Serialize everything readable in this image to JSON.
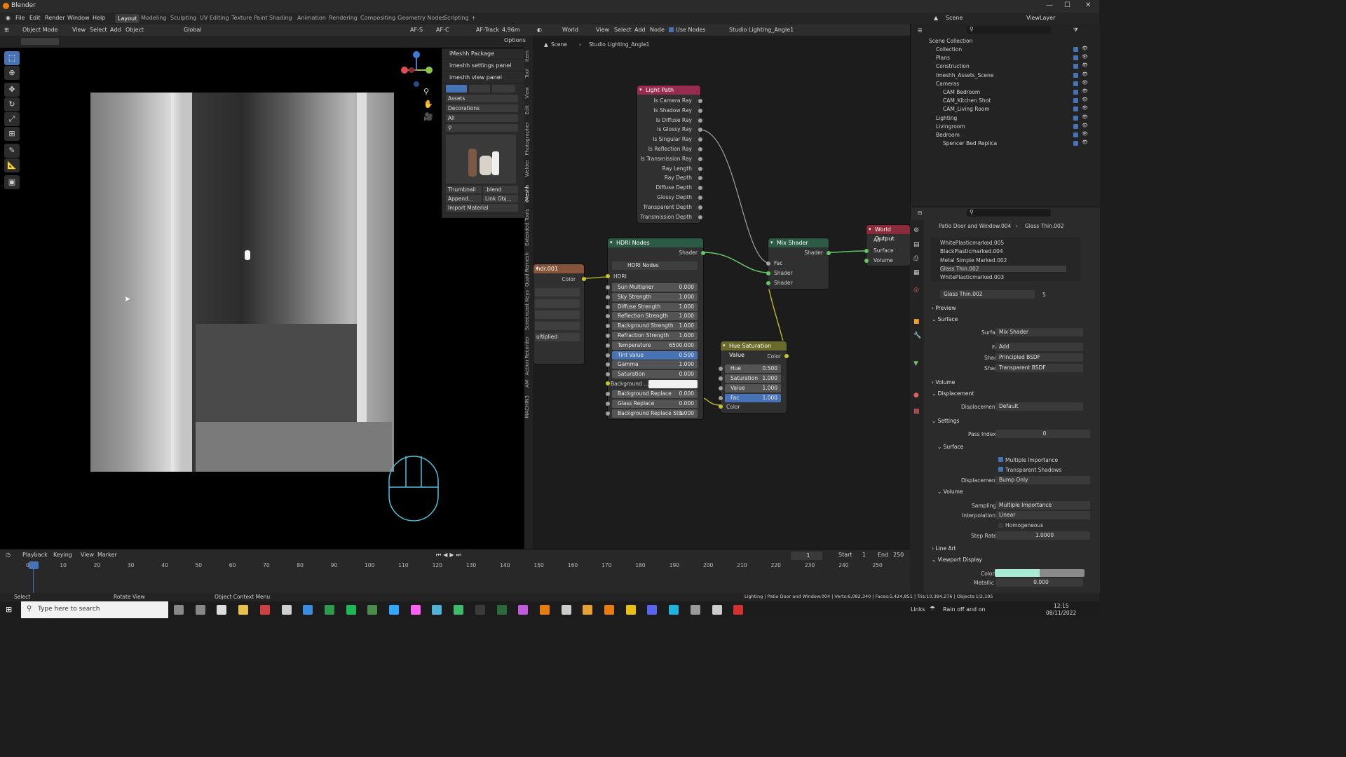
{
  "window": {
    "title": "Blender",
    "minimize": "—",
    "maximize": "☐",
    "close": "✕"
  },
  "menu": [
    "File",
    "Edit",
    "Render",
    "Window",
    "Help"
  ],
  "workspaces": [
    "Layout",
    "Modeling",
    "Sculpting",
    "UV Editing",
    "Texture Paint",
    "Shading",
    "Animation",
    "Rendering",
    "Compositing",
    "Geometry Nodes",
    "Scripting",
    "+"
  ],
  "scene": {
    "name": "Scene",
    "view_layer": "ViewLayer"
  },
  "viewport_header": {
    "mode": "Object Mode",
    "view": "View",
    "select": "Select",
    "add": "Add",
    "object": "Object",
    "orientation": "Global",
    "af_s": "AF-S",
    "af_c": "AF-C",
    "af_track": "AF-Track",
    "focal": "4.96m",
    "options": "Options"
  },
  "imesh_panel": {
    "package": "iMeshh Package",
    "settings": "imeshh settings panel",
    "view": "imeshh view panel",
    "assets": "Assets",
    "category": "Decorations",
    "filter": "All",
    "thumbnail": "Thumbnail",
    "blend": ".blend",
    "append": "Append...",
    "link": "Link Obj...",
    "import_material": "Import Material"
  },
  "sidebar_tabs": [
    "Item",
    "Tool",
    "View",
    "Edit",
    "Photographer",
    "Welder",
    "iMeshh",
    "Extended Tools",
    "Quad Remesh",
    "Screencast Keys",
    "Action Recorder",
    "AM",
    "MACHIN3"
  ],
  "node_header": {
    "editor": "World",
    "view": "View",
    "select": "Select",
    "add": "Add",
    "node": "Node",
    "use_nodes": "Use Nodes",
    "world_name": "Studio Lighting_Angle1"
  },
  "breadcrumb": {
    "scene": "Scene",
    "world": "Studio Lighting_Angle1"
  },
  "nodes": {
    "light_path": {
      "title": "Light Path",
      "outputs": [
        "Is Camera Ray",
        "Is Shadow Ray",
        "Is Diffuse Ray",
        "Is Glossy Ray",
        "Is Singular Ray",
        "Is Reflection Ray",
        "Is Transmission Ray",
        "Ray Length",
        "Ray Depth",
        "Diffuse Depth",
        "Glossy Depth",
        "Transparent Depth",
        "Transmission Depth"
      ]
    },
    "env_texture": {
      "title": ".hdr.001",
      "output": "Color",
      "extension": "ultiplied"
    },
    "hdri": {
      "title": "HDRI Nodes",
      "output": "Shader",
      "group": "HDRI Nodes",
      "input": "HDRI",
      "params": [
        {
          "label": "Sun Multiplier",
          "value": "0.000",
          "active": false
        },
        {
          "label": "Sky Strength",
          "value": "1.000",
          "active": false
        },
        {
          "label": "Diffuse Strength",
          "value": "1.000",
          "active": false
        },
        {
          "label": "Reflection Strength",
          "value": "1.000",
          "active": false
        },
        {
          "label": "Background Strength",
          "value": "1.000",
          "active": false
        },
        {
          "label": "Refraction Strength",
          "value": "1.000",
          "active": false
        },
        {
          "label": "Temperature",
          "value": "6500.000",
          "active": false
        },
        {
          "label": "Tint Value",
          "value": "0.500",
          "active": true
        },
        {
          "label": "Gamma",
          "value": "1.000",
          "active": false
        },
        {
          "label": "Saturation",
          "value": "0.000",
          "active": false
        }
      ],
      "background_color": "Background ...",
      "params2": [
        {
          "label": "Background Replace",
          "value": "0.000"
        },
        {
          "label": "Glass Replace",
          "value": "0.000"
        },
        {
          "label": "Background Replace Stre",
          "value": "1.000"
        }
      ]
    },
    "hue_sat": {
      "title": "Hue Saturation Value",
      "output": "Color",
      "params": [
        {
          "label": "Hue",
          "value": "0.500",
          "active": false
        },
        {
          "label": "Saturation",
          "value": "1.000",
          "active": false
        },
        {
          "label": "Value",
          "value": "1.000",
          "active": false
        },
        {
          "label": "Fac",
          "value": "1.000",
          "active": true
        }
      ],
      "input": "Color"
    },
    "mix_shader": {
      "title": "Mix Shader",
      "output": "Shader",
      "inputs": [
        "Fac",
        "Shader",
        "Shader"
      ]
    },
    "world_output": {
      "title": "World Output",
      "target": "All",
      "inputs": [
        "Surface",
        "Volume"
      ]
    }
  },
  "outliner": {
    "root": "Scene Collection",
    "items": [
      {
        "label": "Collection",
        "indent": 1
      },
      {
        "label": "Plans",
        "indent": 1
      },
      {
        "label": "Construction",
        "indent": 1
      },
      {
        "label": "Imeshh_Assets_Scene",
        "indent": 1
      },
      {
        "label": "Cameras",
        "indent": 1
      },
      {
        "label": "CAM Bedroom",
        "indent": 2
      },
      {
        "label": "CAM_Kitchen Shot",
        "indent": 2
      },
      {
        "label": "CAM_Living Room",
        "indent": 2
      },
      {
        "label": "Lighting",
        "indent": 1
      },
      {
        "label": "Livingroom",
        "indent": 1
      },
      {
        "label": "Bedroom",
        "indent": 1
      },
      {
        "label": "Spencer Bed Replica",
        "indent": 2
      }
    ]
  },
  "properties": {
    "object": "Patio Door and Window.004",
    "material": "Glass Thin.002",
    "slots": [
      "WhitePlasticmarked.005",
      "BlackPlasticmarked.004",
      "Metal Simple Marked.002",
      "Glass Thin.002",
      "WhitePlasticmarked.003"
    ],
    "material_field": "Glass Thin.002",
    "users": "5",
    "preview": "Preview",
    "surface_section": "Surface",
    "surface": "Mix Shader",
    "fac": "Add",
    "shader1": "Principled BSDF",
    "shader2": "Transparent BSDF",
    "labels": {
      "surface": "Surface",
      "fac": "Fac",
      "shader": "Shader",
      "displacement": "Displacement",
      "pass_index": "Pass Index",
      "multiple_importance": "Multiple Importance",
      "transparent_shadows": "Transparent Shadows",
      "sampling": "Sampling",
      "interpolation": "Interpolation",
      "homogeneous": "Homogeneous",
      "step_rate": "Step Rate",
      "color": "Color",
      "metallic": "Metallic"
    },
    "volume_section": "Volume",
    "displacement_section": "Displacement",
    "displacement": "Default",
    "settings_section": "Settings",
    "pass_index": "0",
    "surface_sub": "Surface",
    "surf_displacement": "Bump Only",
    "volume_sub": "Volume",
    "sampling": "Multiple Importance",
    "interpolation": "Linear",
    "step_rate": "1.0000",
    "line_art": "Line Art",
    "viewport_display": "Viewport Display",
    "metallic": "0.000"
  },
  "timeline": {
    "playback": "Playback",
    "keying": "Keying",
    "view": "View",
    "marker": "Marker",
    "current": "1",
    "start_label": "Start",
    "start": "1",
    "end_label": "End",
    "end": "250",
    "ticks": [
      "0",
      "10",
      "20",
      "30",
      "40",
      "50",
      "60",
      "70",
      "80",
      "90",
      "100",
      "110",
      "120",
      "130",
      "140",
      "150",
      "160",
      "170",
      "180",
      "190",
      "200",
      "210",
      "220",
      "230",
      "240",
      "250"
    ]
  },
  "statusbar": {
    "select": "Select",
    "rotate": "Rotate View",
    "context": "Object Context Menu",
    "info": "Lighting | Patio Door and Window.004 | Verts:6,082,340 | Faces:5,424,851 | Tris:10,384,276 | Objects:1/2,195"
  },
  "taskbar": {
    "search": "Type here to search",
    "links": "Links",
    "weather": "Rain off and on",
    "time": "12:15",
    "date": "08/11/2022"
  }
}
